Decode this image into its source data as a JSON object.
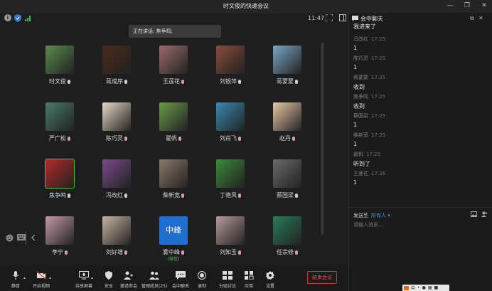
{
  "window": {
    "title": "时文俊的快速会议"
  },
  "topbar": {
    "time": "11:47"
  },
  "speaking": {
    "text": "正在讲话: 焦争鸣;"
  },
  "participants": [
    {
      "name": "时文俊",
      "muted": false,
      "color": "#5c8a4e",
      "row": 0,
      "col": 0
    },
    {
      "name": "蒋成序",
      "muted": false,
      "color": "#4a2a1a",
      "row": 0,
      "col": 1
    },
    {
      "name": "王莲花",
      "muted": true,
      "color": "#9c6b6b",
      "row": 0,
      "col": 2
    },
    {
      "name": "刘银萍",
      "muted": false,
      "color": "#8a4b3c",
      "row": 0,
      "col": 3
    },
    {
      "name": "蒋蒙蒙",
      "muted": false,
      "color": "#7ba6c4",
      "row": 0,
      "col": 4
    },
    {
      "name": "严广松",
      "muted": true,
      "color": "#4a7a6a",
      "row": 1,
      "col": 0
    },
    {
      "name": "陈巧灵",
      "muted": true,
      "color": "#e9d8c4",
      "row": 1,
      "col": 1
    },
    {
      "name": "翟帆",
      "muted": true,
      "color": "#6a9a4a",
      "row": 1,
      "col": 2
    },
    {
      "name": "刘肖飞",
      "muted": true,
      "color": "#3a8ab0",
      "row": 1,
      "col": 3
    },
    {
      "name": "赵丹",
      "muted": true,
      "color": "#e8c8a8",
      "row": 1,
      "col": 4
    },
    {
      "name": "焦争鸣",
      "muted": false,
      "color": "#b22a2a",
      "row": 2,
      "col": 0,
      "active": true
    },
    {
      "name": "冯改红",
      "muted": false,
      "color": "#7a4a8a",
      "row": 2,
      "col": 1
    },
    {
      "name": "柴新宽",
      "muted": true,
      "color": "#8a7a6a",
      "row": 2,
      "col": 2
    },
    {
      "name": "丁艳风",
      "muted": true,
      "color": "#3a8a3a",
      "row": 2,
      "col": 3
    },
    {
      "name": "蔡国梁",
      "muted": false,
      "color": "#6a6a6a",
      "row": 2,
      "col": 4
    },
    {
      "name": "李宁",
      "muted": true,
      "color": "#c49aa8",
      "row": 3,
      "col": 0
    },
    {
      "name": "刘好增",
      "muted": true,
      "color": "#c8b4a4",
      "row": 3,
      "col": 1
    },
    {
      "name": "雾中峰",
      "muted": true,
      "color": "#1e6fd0",
      "row": 3,
      "col": 2,
      "text": "中峰",
      "sub": "(微信)"
    },
    {
      "name": "刘知玉",
      "muted": true,
      "color": "#b89a9a",
      "row": 3,
      "col": 3
    },
    {
      "name": "任宗修",
      "muted": true,
      "color": "#2a7a5a",
      "row": 3,
      "col": 4
    }
  ],
  "toolbar": {
    "buttons": [
      {
        "id": "mute",
        "label": "静音",
        "icon": "microphone-icon"
      },
      {
        "id": "video",
        "label": "开启视频",
        "icon": "camera-off-icon"
      },
      {
        "id": "share",
        "label": "共享屏幕",
        "icon": "screen-share-icon"
      },
      {
        "id": "security",
        "label": "安全",
        "icon": "shield-icon"
      },
      {
        "id": "invite",
        "label": "邀请参会",
        "icon": "add-user-icon"
      },
      {
        "id": "members",
        "label": "管理成员(25)",
        "icon": "members-icon"
      },
      {
        "id": "chat",
        "label": "会中聊天",
        "icon": "chat-bubble-icon"
      },
      {
        "id": "record",
        "label": "录制",
        "icon": "record-icon"
      },
      {
        "id": "breakout",
        "label": "分组讨论",
        "icon": "breakout-icon"
      },
      {
        "id": "apps",
        "label": "应用",
        "icon": "apps-icon"
      },
      {
        "id": "settings",
        "label": "设置",
        "icon": "gear-icon"
      }
    ],
    "end_label": "结束会议"
  },
  "chat": {
    "title": "会中聊天",
    "messages": [
      {
        "sender": "",
        "time": "",
        "content": "我进来了"
      },
      {
        "sender": "冯改红",
        "time": "17:25",
        "content": "1"
      },
      {
        "sender": "陈巧灵",
        "time": "17:25",
        "content": "1"
      },
      {
        "sender": "蒋蒙蒙",
        "time": "17:25",
        "content": "收到"
      },
      {
        "sender": "焦争鸣",
        "time": "17:25",
        "content": "收到"
      },
      {
        "sender": "蔡国梁",
        "time": "17:25",
        "content": "1"
      },
      {
        "sender": "柴新宽",
        "time": "17:25",
        "content": "1"
      },
      {
        "sender": "翟帆",
        "time": "17:25",
        "content": "听到了"
      },
      {
        "sender": "王莲花",
        "time": "17:26",
        "content": "1"
      }
    ],
    "send_to_label": "发送至",
    "send_to_target": "所有人 ▾",
    "input_placeholder": "请输入消息..."
  },
  "ime": {
    "label": "中"
  },
  "colors": {
    "accent": "#4a90e2",
    "end": "#e24a4a",
    "active_border": "#3fbf3f"
  }
}
